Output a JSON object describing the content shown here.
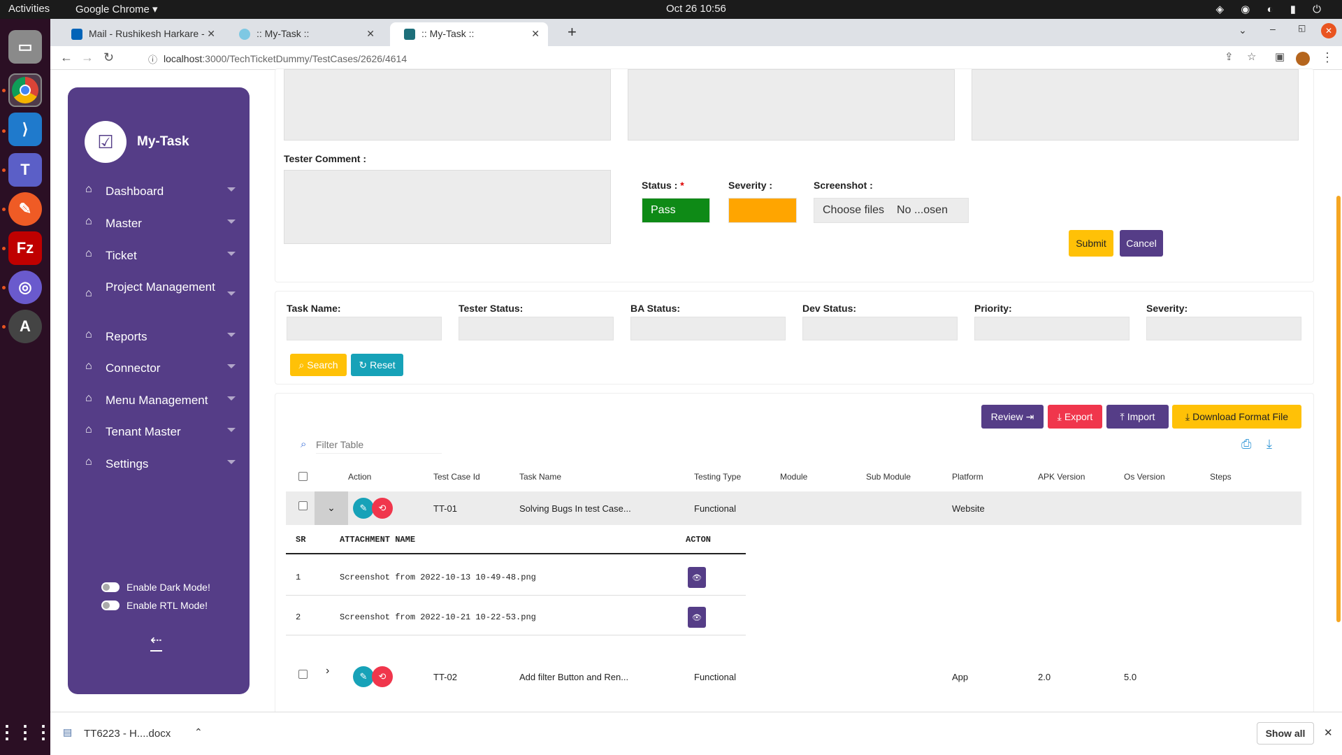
{
  "system": {
    "activities": "Activities",
    "app": "Google Chrome ▾",
    "clock": "Oct 26  10:56"
  },
  "browser": {
    "tabs": [
      {
        "label": "Mail - Rushikesh Harkare -"
      },
      {
        "label": ":: My-Task ::"
      },
      {
        "label": ":: My-Task ::"
      }
    ],
    "url_host": "localhost",
    "url_path": ":3000/TechTicketDummy/TestCases/2626/4614"
  },
  "sidebar": {
    "brand": "My-Task",
    "items": [
      {
        "label": "Dashboard"
      },
      {
        "label": "Master"
      },
      {
        "label": "Ticket"
      },
      {
        "label": "Project Management"
      },
      {
        "label": "Reports"
      },
      {
        "label": "Connector"
      },
      {
        "label": "Menu Management"
      },
      {
        "label": "Tenant Master"
      },
      {
        "label": "Settings"
      }
    ],
    "dark_mode": "Enable Dark Mode!",
    "rtl_mode": "Enable RTL Mode!"
  },
  "form": {
    "tester_comment": "Tester Comment :",
    "status_label": "Status :",
    "required": "*",
    "status_value": "Pass",
    "severity_label": "Severity :",
    "screenshot_label": "Screenshot :",
    "choose_files": "Choose files",
    "no_file": "No ...osen",
    "submit": "Submit",
    "cancel": "Cancel",
    "colors": {
      "pass": "#0e8a16",
      "severity": "#ffa500"
    }
  },
  "filters": {
    "labels": [
      "Task Name:",
      "Tester Status:",
      "BA Status:",
      "Dev Status:",
      "Priority:",
      "Severity:"
    ],
    "search": "Search",
    "reset": "Reset"
  },
  "toolbar": {
    "review": "Review",
    "export": "Export",
    "import": "Import",
    "download": "Download Format File",
    "filter_placeholder": "Filter Table"
  },
  "table": {
    "headers": [
      "Action",
      "Test Case Id",
      "Task Name",
      "Testing Type",
      "Module",
      "Sub Module",
      "Platform",
      "APK Version",
      "Os Version",
      "Steps"
    ],
    "rows": [
      {
        "id": "TT-01",
        "task": "Solving Bugs In test Case...",
        "type": "Functional",
        "module": "",
        "sub_module": "",
        "platform": "Website",
        "apk": "",
        "os": ""
      },
      {
        "id": "TT-02",
        "task": "Add filter Button and Ren...",
        "type": "Functional",
        "module": "",
        "sub_module": "",
        "platform": "App",
        "apk": "2.0",
        "os": "5.0"
      }
    ],
    "attachments": {
      "headers": [
        "SR",
        "ATTACHMENT NAME",
        "ACTON"
      ],
      "rows": [
        {
          "sr": "1",
          "name": "Screenshot from 2022-10-13 10-49-48.png"
        },
        {
          "sr": "2",
          "name": "Screenshot from 2022-10-21 10-22-53.png"
        }
      ]
    }
  },
  "downloads": {
    "file": "TT6223 - H....docx",
    "show_all": "Show all"
  }
}
